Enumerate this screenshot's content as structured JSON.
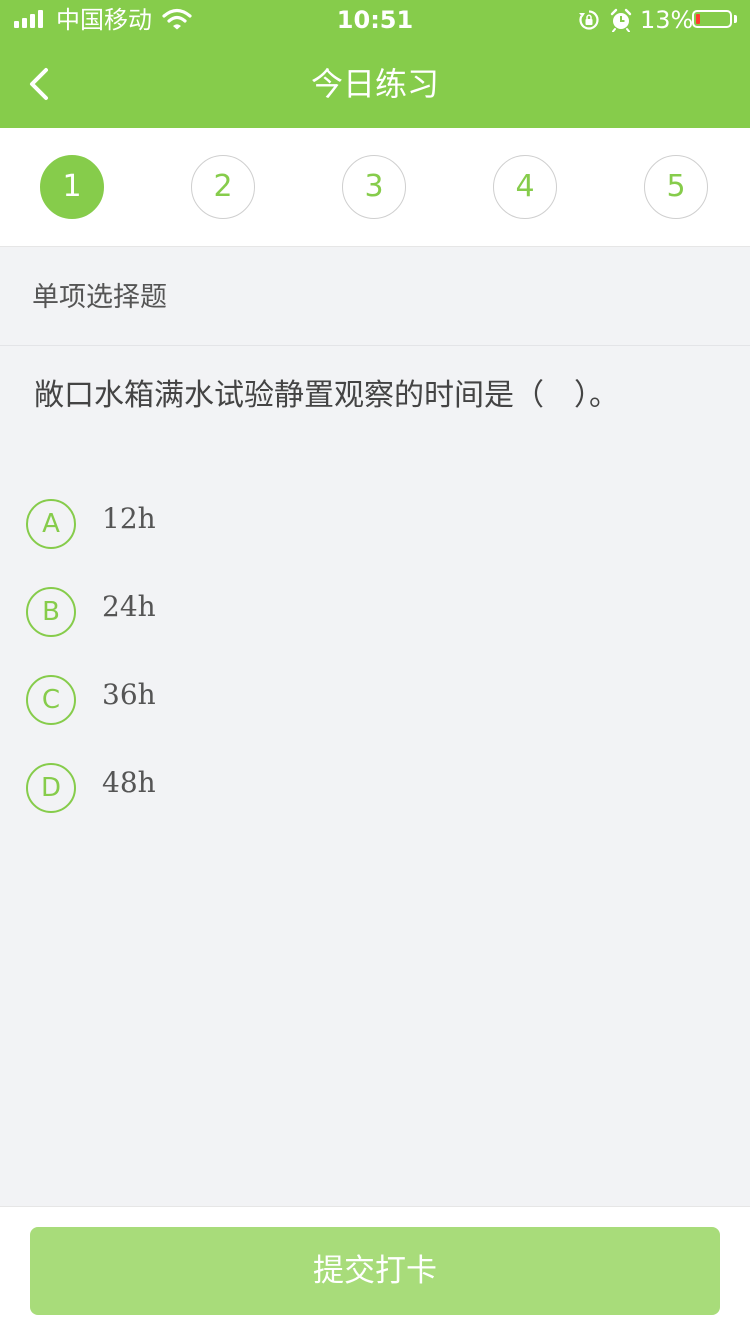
{
  "status_bar": {
    "carrier": "中国移动",
    "time": "10:51",
    "battery": "13%",
    "battery_level": 0.13,
    "icons": [
      "signal-icon",
      "wifi-icon",
      "orientation-lock-icon",
      "alarm-icon",
      "battery-icon"
    ]
  },
  "nav": {
    "title": "今日练习",
    "back_icon": "chevron-left-icon"
  },
  "steps": {
    "items": [
      "1",
      "2",
      "3",
      "4",
      "5"
    ],
    "active_index": 0
  },
  "question": {
    "type_label": "单项选择题",
    "text": "敞口水箱满水试验静置观察的时间是（　）。",
    "options": [
      {
        "letter": "A",
        "text": "12h"
      },
      {
        "letter": "B",
        "text": "24h"
      },
      {
        "letter": "C",
        "text": "36h"
      },
      {
        "letter": "D",
        "text": "48h"
      }
    ]
  },
  "footer": {
    "submit_label": "提交打卡"
  },
  "colors": {
    "brand_green": "#86cc4b",
    "submit_disabled": "#a8dc7a",
    "background": "#f2f3f5"
  }
}
